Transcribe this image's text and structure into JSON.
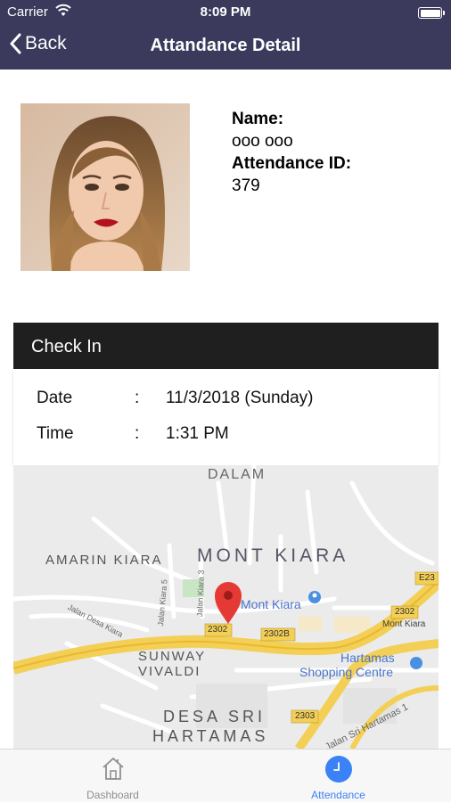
{
  "status_bar": {
    "carrier": "Carrier",
    "time": "8:09 PM"
  },
  "nav": {
    "back_label": "Back",
    "title": "Attandance Detail"
  },
  "profile": {
    "name_label": "Name:",
    "name_value": "ooo ooo",
    "attendance_id_label": "Attendance ID:",
    "attendance_id_value": "379"
  },
  "check_in": {
    "header": "Check In",
    "date_label": "Date",
    "date_value": "11/3/2018 (Sunday)",
    "time_label": "Time",
    "time_value": "1:31 PM",
    "separator": ":"
  },
  "map": {
    "labels": {
      "dalam": "DALAM",
      "mont_kiara_area": "MONT KIARA",
      "amarin_kiara": "AMARIN KIARA",
      "mont_kiara_place": "Mont Kiara",
      "sunway_vivaldi_1": "SUNWAY",
      "sunway_vivaldi_2": "VIVALDI",
      "hartamas_1": "Hartamas",
      "hartamas_2": "Shopping Centre",
      "desa_sri_1": "DESA SRI",
      "desa_sri_2": "HARTAMAS",
      "jalan_desa_kiara": "Jalan Desa Kiara",
      "jalan_kiara_5": "Jalan Kiara 5",
      "jalan_kiara_3": "Jalan Kiara 3",
      "jalan_sri_hartamas_1": "Jalan Sri Hartamas 1",
      "mont_kiara_road": "Mont Kiara"
    },
    "shields": {
      "e23": "E23",
      "r2302a": "2302",
      "r2302b": "2302",
      "r2302c": "2302B",
      "r2303": "2303",
      "r2302d": "2302"
    }
  },
  "tabbar": {
    "tabs": [
      {
        "label": "Dashboard",
        "active": false
      },
      {
        "label": "Attendance",
        "active": true
      }
    ],
    "active_color": "#3b82f6",
    "inactive_color": "#8e8e93"
  },
  "colors": {
    "nav_bg": "#3b3a5c",
    "card_header_bg": "#1f1f1f",
    "pin": "#e53935"
  }
}
